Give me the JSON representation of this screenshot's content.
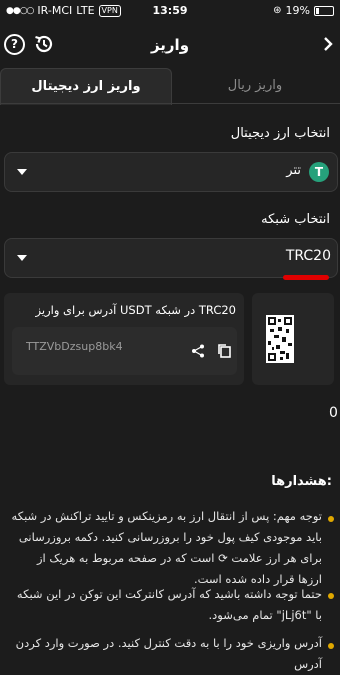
{
  "status": {
    "carrier": "IR-MCI",
    "network": "LTE",
    "vpn": "VPN",
    "time": "13:59",
    "battery": "19%"
  },
  "header": {
    "title": "واریز"
  },
  "tabs": [
    {
      "label": "واریز ارز دیجیتال",
      "active": true
    },
    {
      "label": "واریز ریال",
      "active": false
    }
  ],
  "crypto": {
    "label": "انتخاب ارز دیجیتال",
    "value": "تتر",
    "icon": "tether-icon",
    "icon_symbol": "T"
  },
  "network": {
    "label": "انتخاب شبکه",
    "value": "TRC20"
  },
  "deposit": {
    "caption": "آدرس برای واریز USDT در شبکه TRC20",
    "address": "TTZVbDzsup8bk4"
  },
  "memo_value": "0",
  "warnings": {
    "title": "هشدارها:",
    "items": [
      {
        "text": "توجه مهم: پس از انتقال ارز به رمزینکس و تایید تراکنش در شبکه باید موجودی کیف پول خود را بروزرسانی کنید. دکمه بروزرسانی برای هر ارز علامت ⟳ است که در صفحه مربوط به هریک از ارزها قرار داده شده است."
      },
      {
        "text": "حتما توجه داشته باشید که آدرس کانترکت این توکن در این شبکه با \"jLj6t\" تمام می‌شود."
      },
      {
        "text": "آدرس واریزی خود را با به دقت کنترل کنید. در صورت وارد کردن آدرس"
      }
    ]
  },
  "colors": {
    "accent": "#e0a800",
    "underline": "#e00000",
    "tether": "#26a17b"
  }
}
